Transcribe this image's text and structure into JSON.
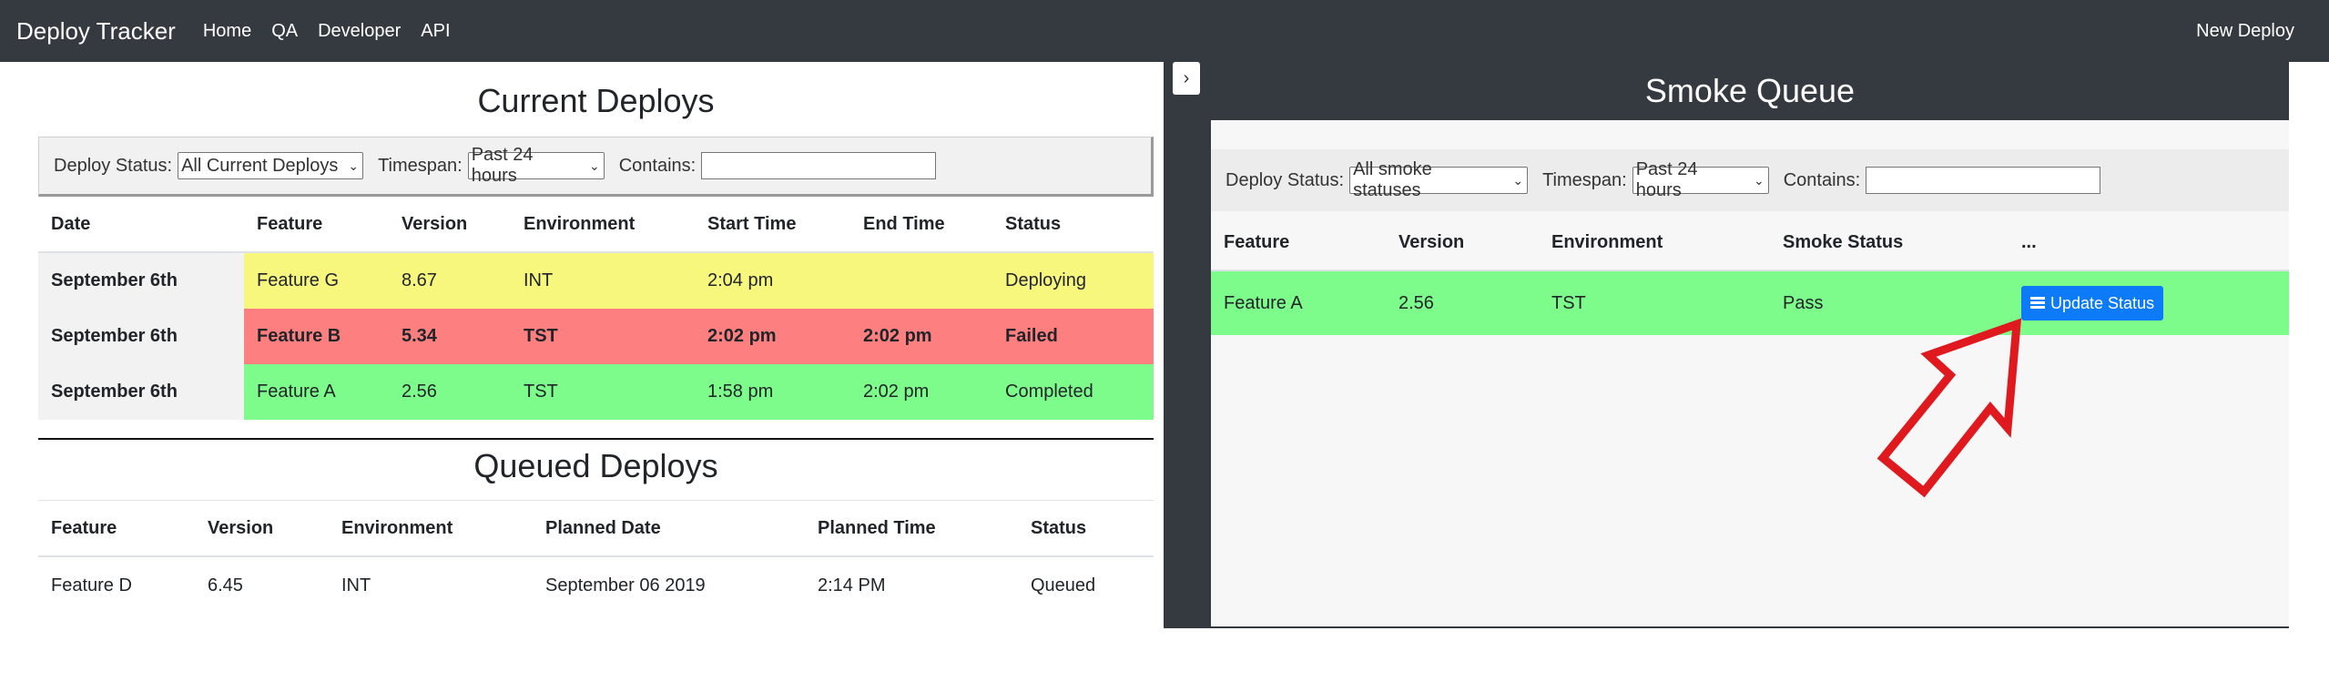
{
  "navbar": {
    "brand": "Deploy Tracker",
    "links": [
      "Home",
      "QA",
      "Developer",
      "API"
    ],
    "right_link": "New Deploy"
  },
  "current": {
    "title": "Current Deploys",
    "filters": {
      "status_label": "Deploy Status:",
      "status_value": "All Current Deploys",
      "timespan_label": "Timespan:",
      "timespan_value": "Past 24 hours",
      "contains_label": "Contains:",
      "contains_value": ""
    },
    "columns": [
      "Date",
      "Feature",
      "Version",
      "Environment",
      "Start Time",
      "End Time",
      "Status"
    ],
    "rows": [
      {
        "date": "September 6th",
        "feature": "Feature G",
        "version": "8.67",
        "environment": "INT",
        "start": "2:04 pm",
        "end": "",
        "status": "Deploying",
        "color": "#f7f77d"
      },
      {
        "date": "September 6th",
        "feature": "Feature B",
        "version": "5.34",
        "environment": "TST",
        "start": "2:02 pm",
        "end": "2:02 pm",
        "status": "Failed",
        "color": "#fe7f7f"
      },
      {
        "date": "September 6th",
        "feature": "Feature A",
        "version": "2.56",
        "environment": "TST",
        "start": "1:58 pm",
        "end": "2:02 pm",
        "status": "Completed",
        "color": "#7dfc8c"
      }
    ]
  },
  "queued": {
    "title": "Queued Deploys",
    "columns": [
      "Feature",
      "Version",
      "Environment",
      "Planned Date",
      "Planned Time",
      "Status"
    ],
    "rows": [
      {
        "feature": "Feature D",
        "version": "6.45",
        "environment": "INT",
        "planned_date": "September 06 2019",
        "planned_time": "2:14 PM",
        "status": "Queued"
      }
    ]
  },
  "smoke": {
    "toggle_icon": "chevron-right-icon",
    "title": "Smoke Queue",
    "filters": {
      "status_label": "Deploy Status:",
      "status_value": "All smoke statuses",
      "timespan_label": "Timespan:",
      "timespan_value": "Past 24 hours",
      "contains_label": "Contains:",
      "contains_value": ""
    },
    "columns": [
      "Feature",
      "Version",
      "Environment",
      "Smoke Status",
      "..."
    ],
    "rows": [
      {
        "feature": "Feature A",
        "version": "2.56",
        "environment": "TST",
        "smoke_status": "Pass",
        "action_label": "Update Status",
        "color": "#7dfc8c"
      }
    ]
  },
  "colors": {
    "navbar": "#343a40",
    "primary": "#0d7af8",
    "arrow": "#e0191f"
  }
}
